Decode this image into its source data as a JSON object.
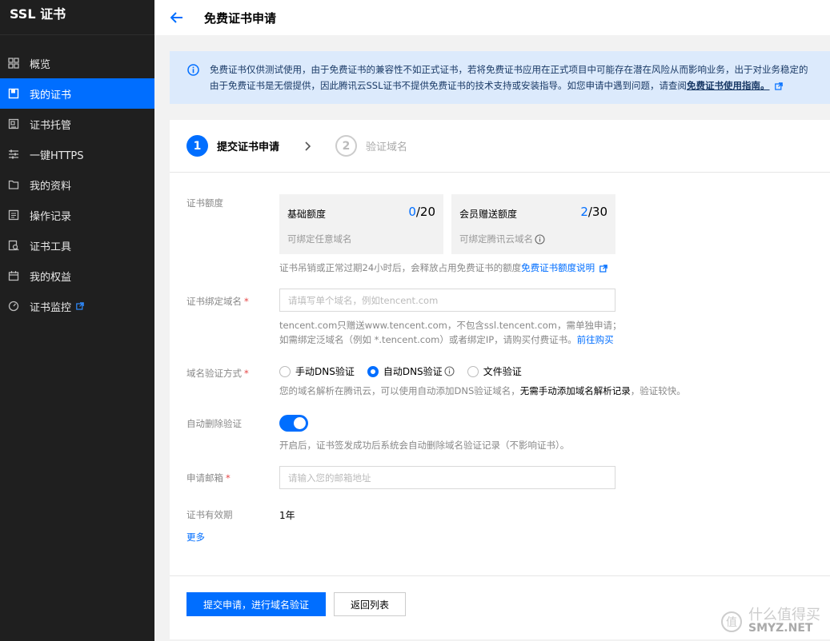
{
  "sidebar": {
    "title": "SSL 证书",
    "items": [
      {
        "label": "概览",
        "icon": "grid-icon",
        "active": false
      },
      {
        "label": "我的证书",
        "icon": "certificate-icon",
        "active": true
      },
      {
        "label": "证书托管",
        "icon": "hosting-icon",
        "active": false
      },
      {
        "label": "一键HTTPS",
        "icon": "sliders-icon",
        "active": false
      },
      {
        "label": "我的资料",
        "icon": "folder-icon",
        "active": false
      },
      {
        "label": "操作记录",
        "icon": "log-icon",
        "active": false
      },
      {
        "label": "证书工具",
        "icon": "tool-icon",
        "active": false
      },
      {
        "label": "我的权益",
        "icon": "calendar-icon",
        "active": false
      },
      {
        "label": "证书监控",
        "icon": "gauge-icon",
        "active": false
      }
    ]
  },
  "header": {
    "title": "免费证书申请"
  },
  "notice": {
    "line1": "免费证书仅供测试使用，由于免费证书的兼容性不如正式证书，若将免费证书应用在正式项目中可能存在潜在风险从而影响业务，出于对业务稳定的",
    "line2": "由于免费证书是无偿提供，因此腾讯云SSL证书不提供免费证书的技术支持或安装指导。如您申请中遇到问题，请查阅",
    "link": "免费证书使用指南。"
  },
  "steps": [
    {
      "num": "1",
      "label": "提交证书申请"
    },
    {
      "num": "2",
      "label": "验证域名"
    }
  ],
  "form": {
    "quota_label": "证书额度",
    "quota_basic": {
      "title": "基础额度",
      "used": "0",
      "total": "/20",
      "sub": "可绑定任意域名"
    },
    "quota_member": {
      "title": "会员赠送额度",
      "used": "2",
      "total": "/30",
      "sub": "可绑定腾讯云域名"
    },
    "quota_hint": "证书吊销或正常过期24小时后，会释放占用免费证书的额度",
    "quota_hint_link": "免费证书额度说明",
    "domain_label": "证书绑定域名",
    "domain_placeholder": "请填写单个域名，例如tencent.com",
    "domain_hint1": "tencent.com只赠送www.tencent.com，不包含ssl.tencent.com，需单独申请；",
    "domain_hint2": "如需绑定泛域名（例如 *.tencent.com）或者绑定IP，请购买付费证书。",
    "domain_hint2_link": "前往购买",
    "verify_label": "域名验证方式",
    "verify_options": [
      "手动DNS验证",
      "自动DNS验证",
      "文件验证"
    ],
    "verify_hint_a": "您的域名解析在腾讯云，可以使用自动添加DNS验证域名，",
    "verify_hint_b": "无需手动添加域名解析记录",
    "verify_hint_c": "，验证较快。",
    "auto_delete_label": "自动删除验证",
    "auto_delete_hint": "开启后，证书签发成功后系统会自动删除域名验证记录（不影响证书）。",
    "email_label": "申请邮箱",
    "email_placeholder": "请输入您的邮箱地址",
    "validity_label": "证书有效期",
    "validity_value": "1年",
    "more": "更多"
  },
  "buttons": {
    "submit": "提交申请，进行域名验证",
    "back": "返回列表"
  },
  "watermark": {
    "cn": "什么值得买",
    "en": "SMYZ.NET"
  },
  "colors": {
    "accent": "#006eff",
    "sidebar_bg": "#1f1f1f",
    "notice_bg": "#dceafc"
  }
}
